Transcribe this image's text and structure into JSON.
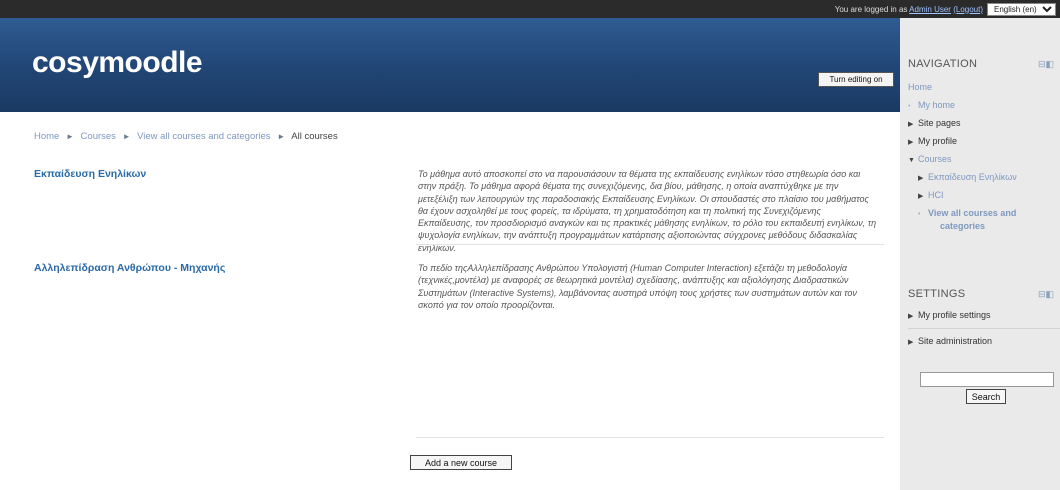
{
  "topbar": {
    "logged_in_prefix": "You are logged in as",
    "user_name": "Admin User",
    "logout_label": "(Logout)",
    "language": "English (en)"
  },
  "header": {
    "site_name": "cosymoodle",
    "turn_editing_label": "Turn editing on"
  },
  "breadcrumb": {
    "items": [
      "Home",
      "Courses",
      "View all courses and categories",
      "All courses"
    ]
  },
  "courses": [
    {
      "name": "Εκπαίδευση Ενηλίκων",
      "summary": "Το μάθημα αυτό αποσκοπεί στο να παρουσιάσουν τα θέματα της εκπαίδευσης ενηλίκων τόσο στηθεωρία όσο και στην πράξη. Το μάθημα αφορά θέματα της συνεχιζόμενης, δια βίου, μάθησης, η οποία αναπτύχθηκε με την μετεξέλιξη των λειτουργιών της παραδοσιακής Εκπαίδευσης Ενηλίκων. Οι σπουδαστές στο πλαίσιο του μαθήματος θα έχουν ασχοληθεί με τους φορείς, τα ιδρύματα, τη χρηματοδότηση και τη πολιτική της Συνεχιζόμενης Εκπαίδευσης, τον προσδιορισμό αναγκών και τις πρακτικές μάθησης ενηλίκων, το ρόλο του εκπαιδευτή ενηλίκων, τη ψυχολογία ενηλίκων, την ανάπτυξη προγραμμάτων κατάρτισης αξιοποιώντας σύγχρονες μεθόδους διδασκαλίας ενηλίκων."
    },
    {
      "name": "Αλληλεπίδραση Ανθρώπου - Μηχανής",
      "summary": "Το πεδίο τηςΑλληλεπίδρασης Ανθρώπου Υπολογιστή (Human Computer Interaction) εξετάζει τη μεθοδολογία (τεχνικές,μοντέλα) με αναφορές σε θεωρητικά μοντέλα) σχεδίασης, ανάπτυξης και αξιολόγησης Διαδραστικών Συστημάτων (Interactive Systems), λαμβάνοντας αυστηρά υπόψη τους χρήστες των συστημάτων αυτών και τον σκοπό για τον οποίο προορίζονται."
    }
  ],
  "add_course_label": "Add a new course",
  "sidebar": {
    "navigation": {
      "title": "NAVIGATION",
      "control": "⊟◧",
      "home": "Home",
      "my_home": "My home",
      "site_pages": "Site pages",
      "my_profile": "My profile",
      "courses": "Courses",
      "course1": "Εκπαίδευση Ενηλίκων",
      "course2": "HCI",
      "view_all_line1": "View all courses and",
      "view_all_line2": "categories"
    },
    "settings": {
      "title": "SETTINGS",
      "control": "⊟◧",
      "profile_settings": "My profile settings",
      "site_admin": "Site administration",
      "search_label": "Search",
      "search_value": ""
    }
  },
  "colors": {
    "header_top": "#2e5c93",
    "header_bottom": "#1a3a63",
    "link": "#2b6aa8",
    "sidebar_bg": "#eaeaea"
  }
}
